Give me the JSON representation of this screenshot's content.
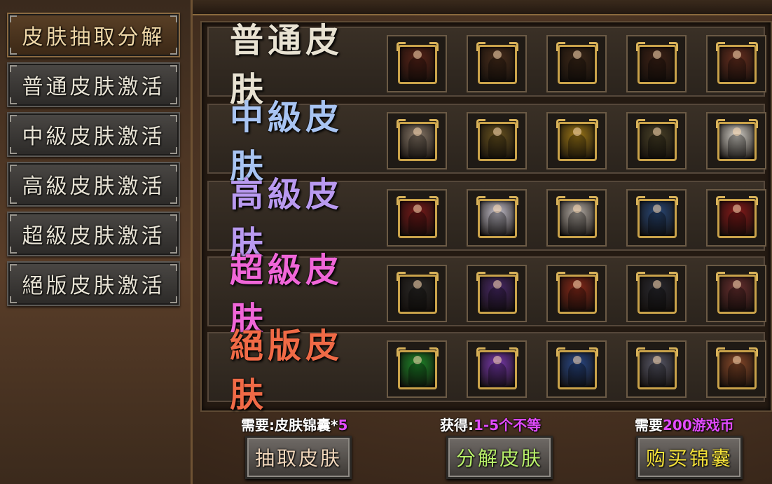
{
  "sidebar": {
    "items": [
      {
        "label": "皮肤抽取分解",
        "active": true
      },
      {
        "label": "普通皮肤激活",
        "active": false
      },
      {
        "label": "中級皮肤激活",
        "active": false
      },
      {
        "label": "高級皮肤激活",
        "active": false
      },
      {
        "label": "超級皮肤激活",
        "active": false
      },
      {
        "label": "絕版皮肤激活",
        "active": false
      }
    ]
  },
  "tiers": [
    {
      "label": "普通皮肤",
      "color": "#e8e2d2",
      "slot_colors": [
        "#5a2418",
        "#4a2e1c",
        "#3d2818",
        "#3e2216",
        "#6a3020"
      ]
    },
    {
      "label": "中級皮肤",
      "color": "#a8c4f2",
      "slot_colors": [
        "#8a7a6a",
        "#6a5420",
        "#a07a18",
        "#4a4228",
        "#d8d4cc"
      ]
    },
    {
      "label": "高級皮肤",
      "color": "#b99af0",
      "slot_colors": [
        "#7a1a1a",
        "#c8c4d0",
        "#b8b0a8",
        "#2a4a7a",
        "#8a1a1a"
      ]
    },
    {
      "label": "超級皮肤",
      "color": "#f066d8",
      "slot_colors": [
        "#2a2826",
        "#4a2a6a",
        "#8a2a1a",
        "#2a2a30",
        "#6a3030"
      ]
    },
    {
      "label": "絕版皮肤",
      "color": "#f06a46",
      "slot_colors": [
        "#1e8a2a",
        "#7a3ab0",
        "#2a4a8a",
        "#5a5a6a",
        "#8a4a2a"
      ]
    }
  ],
  "actions": [
    {
      "req_prefix": "需要:皮肤锦囊*",
      "req_value": "5",
      "button_label": "抽取皮肤",
      "button_color": "#f2d8bc"
    },
    {
      "req_prefix": "获得:",
      "req_value": "1-5个不等",
      "button_label": "分解皮肤",
      "button_color": "#b8f06a"
    },
    {
      "req_prefix": "需要",
      "req_value": "200游戏币",
      "button_label": "购买锦囊",
      "button_color": "#f5e23a"
    }
  ]
}
